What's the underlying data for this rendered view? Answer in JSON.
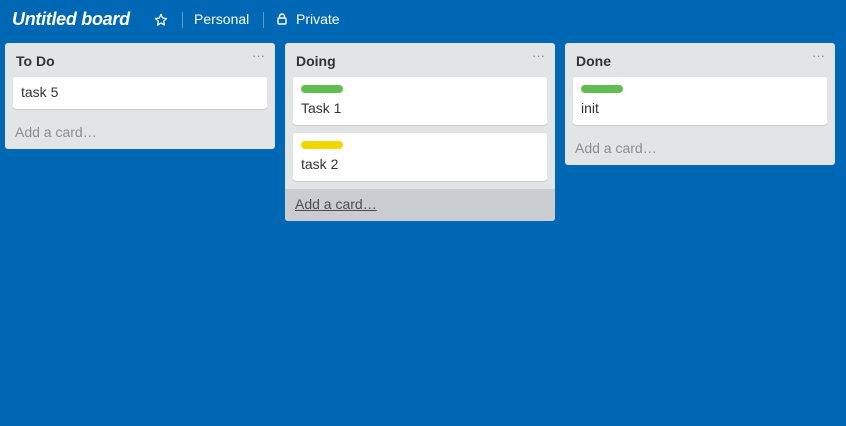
{
  "colors": {
    "background": "#0067b4",
    "list_bg": "#e2e4e6",
    "label_green": "#61bd4f",
    "label_yellow": "#f2d600"
  },
  "header": {
    "title": "Untitled board",
    "star_icon": "star-outline-icon",
    "team": "Personal",
    "visibility_icon": "lock-icon",
    "visibility": "Private"
  },
  "lists": [
    {
      "title": "To Do",
      "menu": "···",
      "cards": [
        {
          "text": "task 5",
          "label": null
        }
      ],
      "add_card": "Add a card…"
    },
    {
      "title": "Doing",
      "menu": "···",
      "cards": [
        {
          "text": "Task 1",
          "label": "#61bd4f"
        },
        {
          "text": "task 2",
          "label": "#f2d600"
        }
      ],
      "add_card": "Add a card…"
    },
    {
      "title": "Done",
      "menu": "···",
      "cards": [
        {
          "text": "init",
          "label": "#61bd4f"
        }
      ],
      "add_card": "Add a card…"
    }
  ]
}
